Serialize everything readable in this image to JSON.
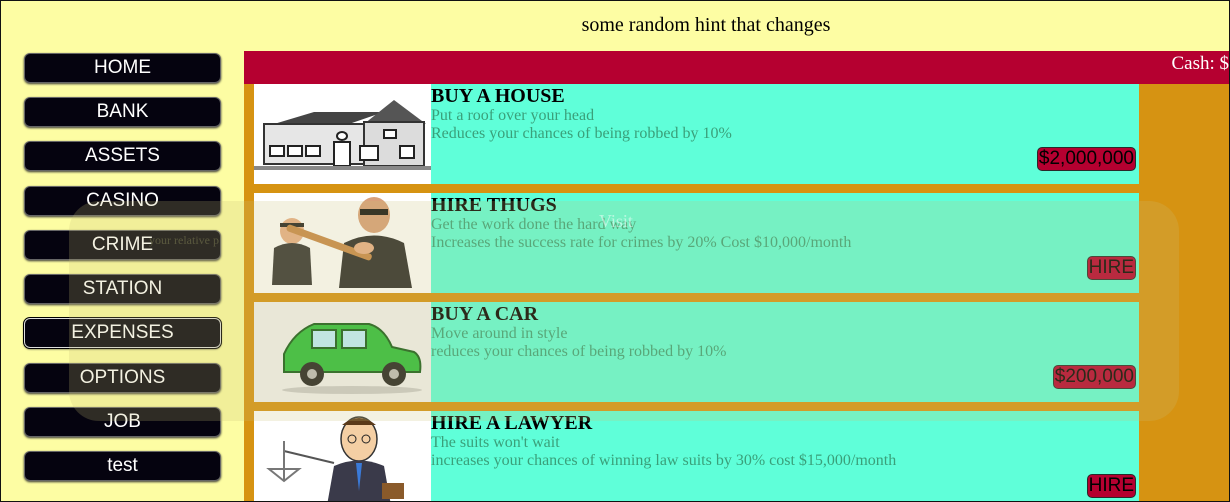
{
  "hint": "some random hint that changes",
  "nav": [
    {
      "label": "HOME"
    },
    {
      "label": "BANK"
    },
    {
      "label": "ASSETS"
    },
    {
      "label": "CASINO"
    },
    {
      "label": "CRIME"
    },
    {
      "label": "STATION"
    },
    {
      "label": "EXPENSES",
      "active": true
    },
    {
      "label": "OPTIONS"
    },
    {
      "label": "JOB"
    },
    {
      "label": "test"
    }
  ],
  "cash_label": "Cash: $",
  "overlay": {
    "title": "Visit",
    "line": "your relative p"
  },
  "cards": [
    {
      "title": "BUY A HOUSE",
      "line1": "Put a roof over your head",
      "line2": "Reduces your chances of being robbed by 10%",
      "button": "$2,000,000",
      "image": "house-icon"
    },
    {
      "title": "HIRE THUGS",
      "line1": "Get the work done the hard way",
      "line2": "Increases the success rate for crimes by 20% Cost $10,000/month",
      "button": "HIRE",
      "image": "thugs-icon"
    },
    {
      "title": "BUY A CAR",
      "line1": "Move around in style",
      "line2": "reduces your chances of being robbed by 10%",
      "button": "$200,000",
      "image": "car-icon"
    },
    {
      "title": "HIRE A LAWYER",
      "line1": "The suits won't wait",
      "line2": "increases your chances of winning law suits by 30% cost $15,000/month",
      "button": "HIRE",
      "image": "lawyer-icon"
    }
  ],
  "colors": {
    "sidebar": "#fdfda3",
    "main": "#d69312",
    "cashbar": "#b50030",
    "card": "#5fffd9",
    "nav_button": "#05030f"
  }
}
